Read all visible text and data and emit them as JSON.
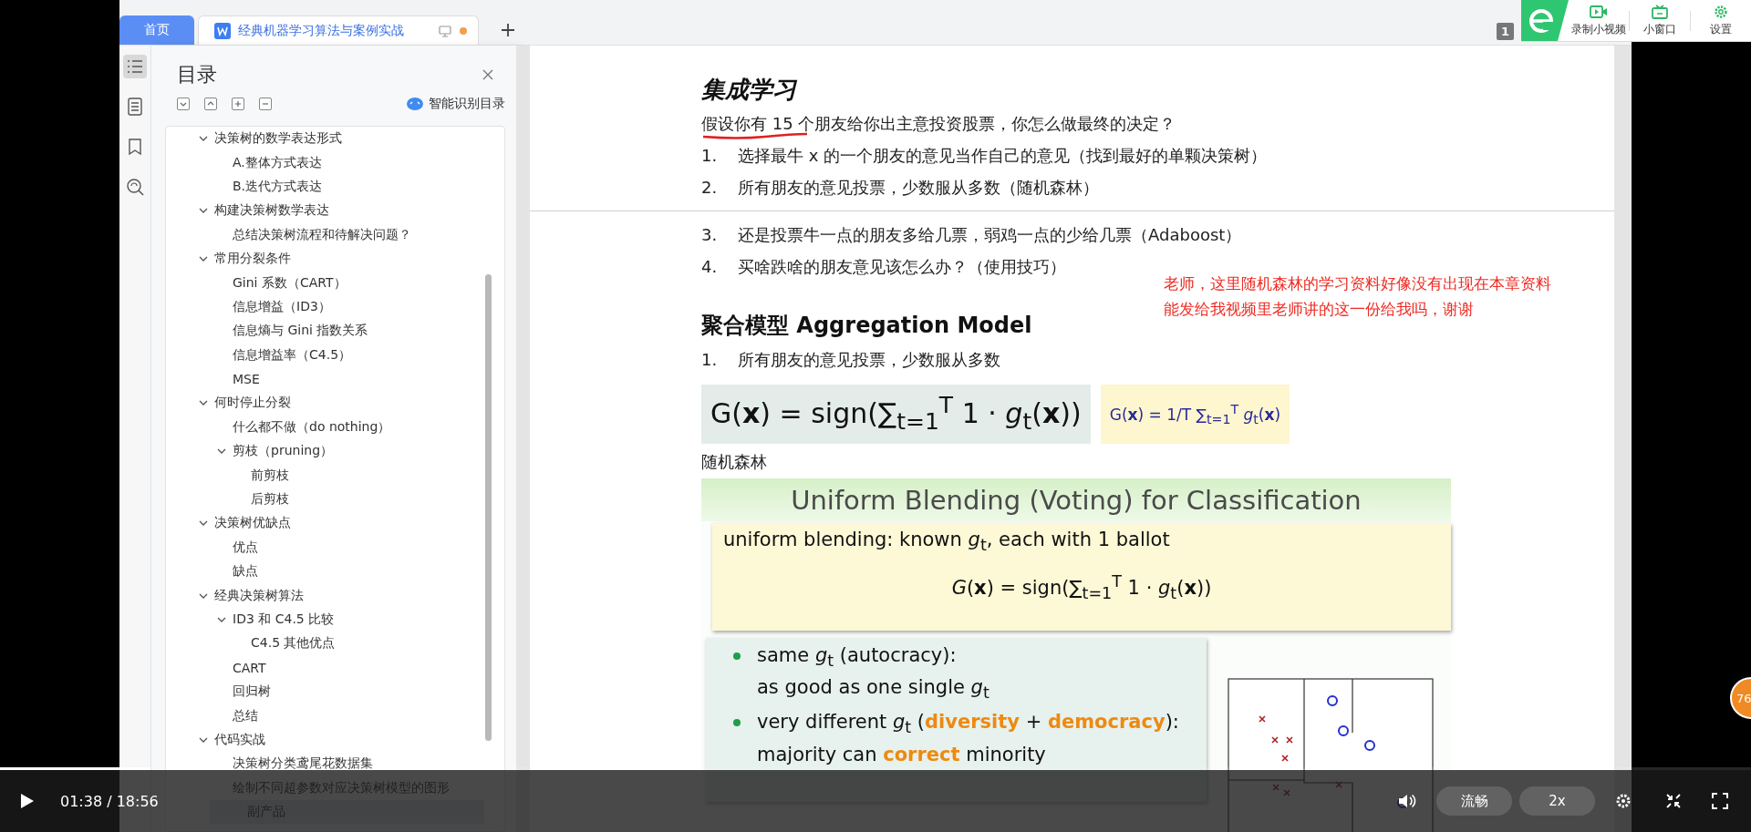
{
  "tabs": [
    {
      "label": "首页",
      "kind": "home",
      "selected": false
    },
    {
      "label": "经典机器学习算法与案例实战",
      "kind": "doc",
      "selected": true,
      "unsaved": true
    }
  ],
  "page_badge": "1",
  "toolbar": [
    {
      "label": "录制小视频",
      "kind": "record"
    },
    {
      "label": "小窗口",
      "kind": "window"
    },
    {
      "label": "设置",
      "kind": "settings"
    }
  ],
  "rail": [
    {
      "kind": "outline",
      "selected": true
    },
    {
      "kind": "pages",
      "selected": false
    },
    {
      "kind": "bookmark",
      "selected": false
    },
    {
      "kind": "find",
      "selected": false
    }
  ],
  "toc": {
    "title": "目录",
    "smart_button": "智能识别目录",
    "items": [
      {
        "label": "决策树的数学表达形式",
        "selected": false,
        "expanded": true,
        "children": [
          {
            "label": "A.整体方式表达",
            "selected": false
          },
          {
            "label": "B.迭代方式表达",
            "selected": false
          }
        ]
      },
      {
        "label": "构建决策树数学表达",
        "selected": false,
        "expanded": true,
        "children": [
          {
            "label": "总结决策树流程和待解决问题？",
            "selected": false
          }
        ]
      },
      {
        "label": "常用分裂条件",
        "selected": false,
        "expanded": true,
        "children": [
          {
            "label": "Gini 系数（CART）",
            "selected": false
          },
          {
            "label": "信息增益（ID3）",
            "selected": false
          },
          {
            "label": "信息熵与 Gini 指数关系",
            "selected": false
          },
          {
            "label": "信息增益率（C4.5）",
            "selected": false
          },
          {
            "label": "MSE",
            "selected": false
          }
        ]
      },
      {
        "label": "何时停止分裂",
        "selected": false,
        "expanded": true,
        "children": [
          {
            "label": "什么都不做（do nothing）",
            "selected": false
          },
          {
            "label": "剪枝（pruning）",
            "selected": false,
            "expanded": true,
            "children": [
              {
                "label": "前剪枝",
                "selected": false
              },
              {
                "label": "后剪枝",
                "selected": false
              }
            ]
          }
        ]
      },
      {
        "label": "决策树优缺点",
        "selected": false,
        "expanded": true,
        "children": [
          {
            "label": "优点",
            "selected": false
          },
          {
            "label": "缺点",
            "selected": false
          }
        ]
      },
      {
        "label": "经典决策树算法",
        "selected": false,
        "expanded": true,
        "children": [
          {
            "label": "ID3 和 C4.5 比较",
            "selected": false,
            "expanded": true,
            "children": [
              {
                "label": "C4.5 其他优点",
                "selected": false
              }
            ]
          },
          {
            "label": "CART",
            "selected": false
          },
          {
            "label": "回归树",
            "selected": false
          },
          {
            "label": "总结",
            "selected": false
          }
        ]
      },
      {
        "label": "代码实战",
        "selected": false,
        "expanded": true,
        "children": [
          {
            "label": "决策树分类鸢尾花数据集",
            "selected": false
          },
          {
            "label": "绘制不同超参数对应决策树模型的图形",
            "selected": false
          },
          {
            "label": "副产品",
            "selected": true
          }
        ]
      }
    ]
  },
  "document": {
    "blocks": [
      {
        "kind": "title",
        "text": "集成学习"
      },
      {
        "kind": "question",
        "text": "假设你有 15 个朋友给你出主意投资股票，你怎么做最终的决定？",
        "annotated": true
      },
      {
        "kind": "item",
        "number": "1.",
        "text": "选择最牛 x 的一个朋友的意见当作自己的意见（找到最好的单颗决策树）"
      },
      {
        "kind": "item",
        "number": "2.",
        "text": "所有朋友的意见投票，少数服从多数（随机森林）"
      },
      {
        "kind": "page-break"
      },
      {
        "kind": "item",
        "number": "3.",
        "text": "还是投票牛一点的朋友多给几票，弱鸡一点的少给几票（Adaboost）"
      },
      {
        "kind": "item",
        "number": "4.",
        "text": "买啥跌啥的朋友意见该怎么办？（使用技巧）"
      },
      {
        "kind": "heading",
        "text": "聚合模型  Aggregation Model"
      },
      {
        "kind": "item",
        "number": "1.",
        "text": "所有朋友的意见投票，少数服从多数"
      },
      {
        "kind": "formulas",
        "items": [
          "G(**x**) = sign(∑$_{t=1}$$^{T}$ 1 · *g*$_{t}$(**x**))",
          "G(**x**) = 1/T ∑$_{t=1}$$^{T}$ *g*$_{t}$(**x**)"
        ]
      },
      {
        "kind": "caption",
        "text": "随机森林"
      },
      {
        "kind": "slide",
        "title": "Uniform Blending (Voting) for Classification",
        "rule": "uniform blending: known *g*$_{t}$, each with 1 ballot",
        "formula": "*G*(**x**) = sign(∑$_{t=1}$$^{T}$ 1 · *g*$_{t}$(**x**))",
        "bullets": [
          {
            "lines": [
              "same *g*$_{t}$ (autocracy):",
              "as good as one single *g*$_{t}$"
            ]
          },
          {
            "lines": [
              "very different *g*$_{t}$ (**diversity** + **democracy**):",
              "majority can **correct** minority"
            ]
          }
        ]
      }
    ]
  },
  "comment": {
    "lines": [
      "老师，这里随机森林的学习资料好像没有出现在本章资料",
      "能发给我视频里老师讲的这一份给我吗，谢谢"
    ]
  },
  "player": {
    "playing": false,
    "time": "01:38 / 18:56",
    "progress": {
      "level": 0.086
    },
    "quality": "流畅",
    "speed": "2x"
  },
  "side_badge": "76"
}
